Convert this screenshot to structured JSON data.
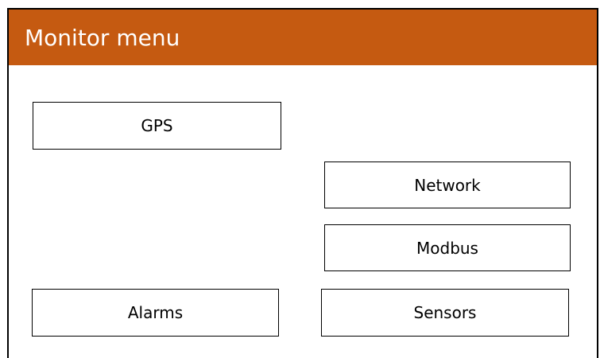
{
  "header": {
    "title": "Monitor menu",
    "background_color": "#c55a11",
    "text_color": "#ffffff"
  },
  "menu": {
    "gps_label": "GPS",
    "network_label": "Network",
    "modbus_label": "Modbus",
    "alarms_label": "Alarms",
    "sensors_label": "Sensors"
  }
}
